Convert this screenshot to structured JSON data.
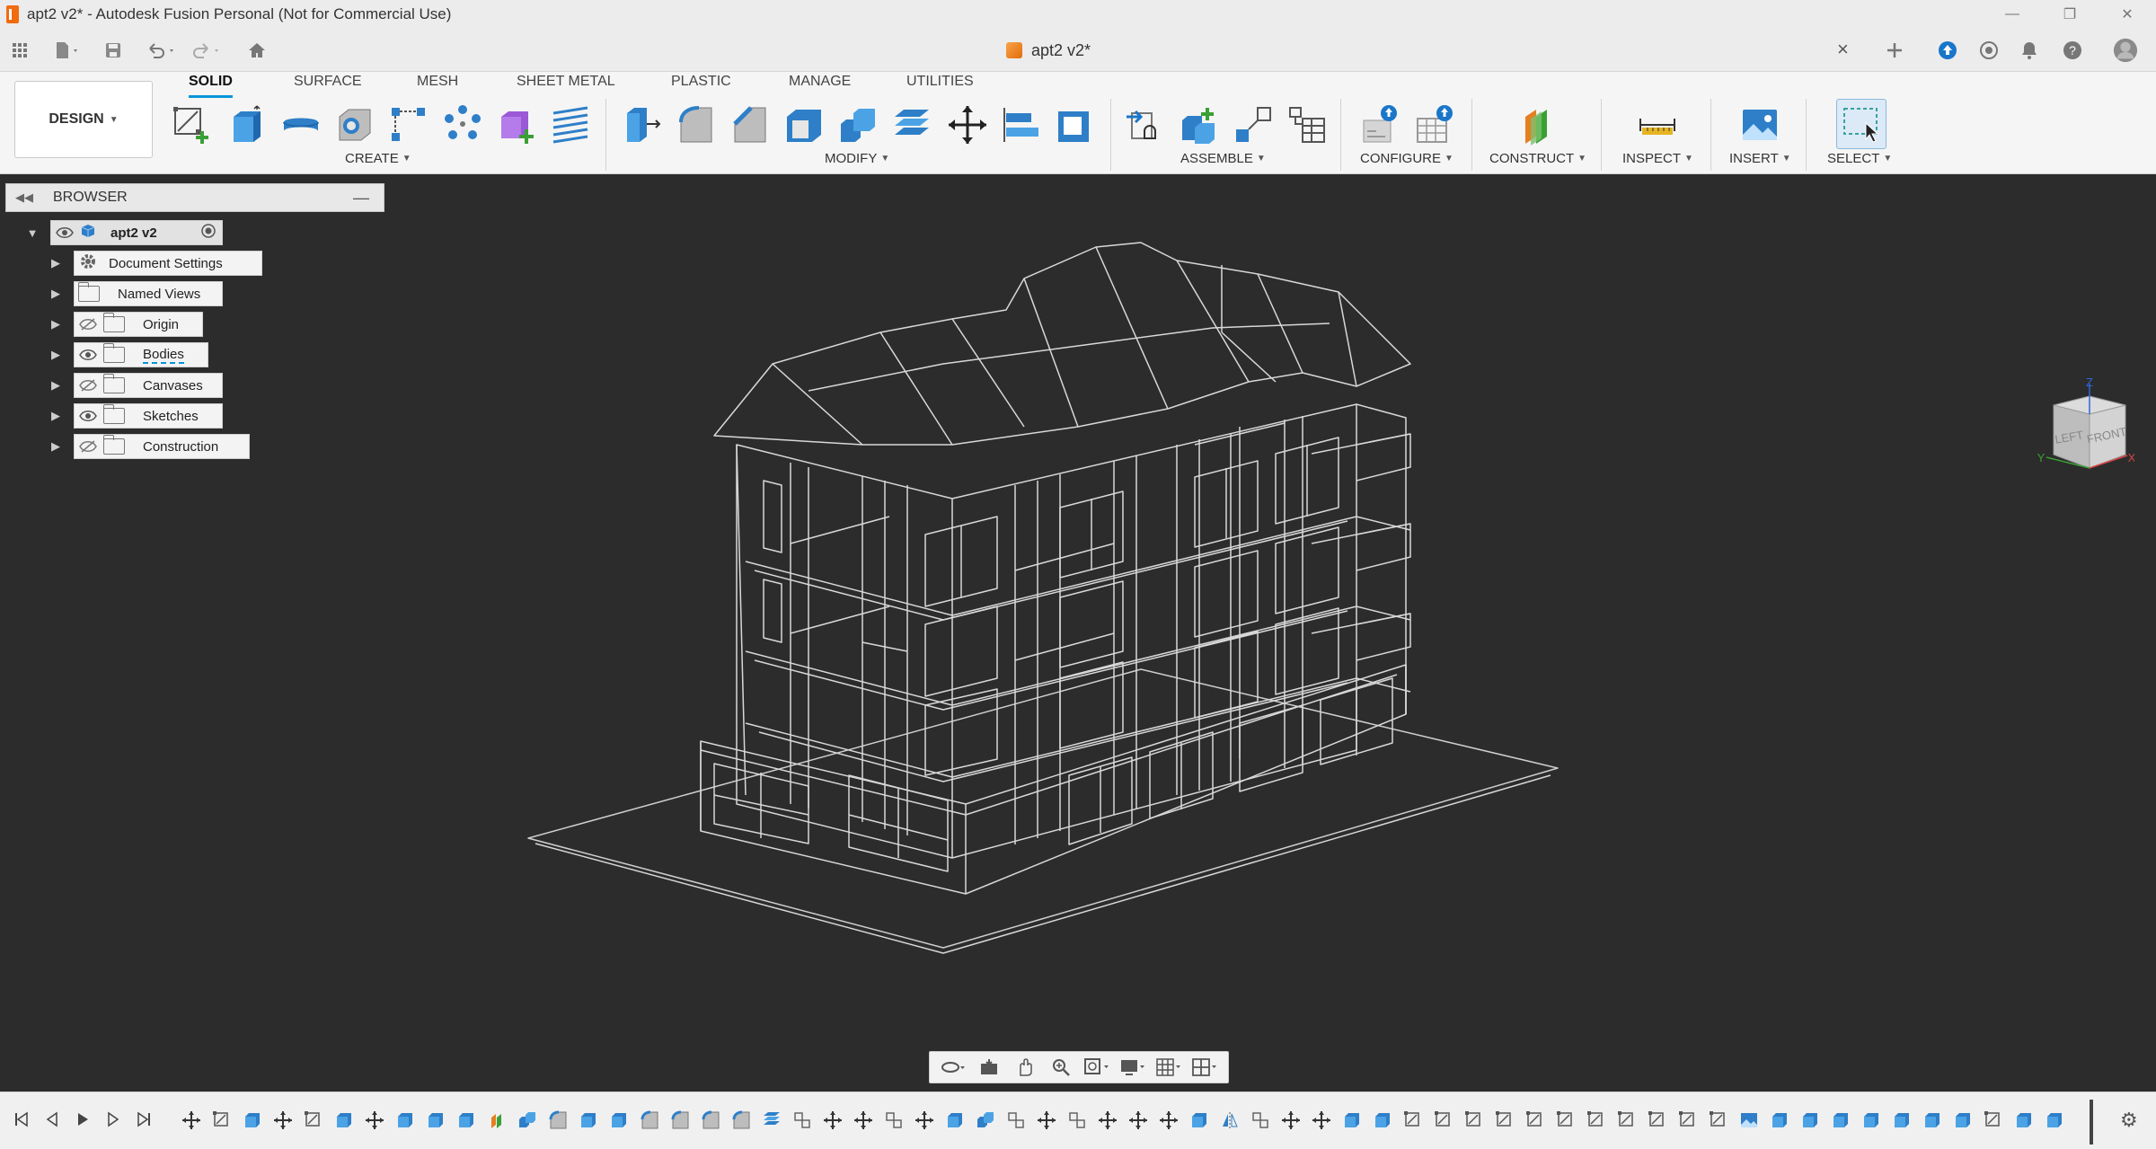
{
  "window": {
    "title": "apt2 v2* - Autodesk Fusion Personal (Not for Commercial Use)",
    "controls": [
      "minimize-icon",
      "restore-icon",
      "close-icon"
    ]
  },
  "document_tab": {
    "name": "apt2 v2*",
    "close": "×"
  },
  "quick_access": [
    "grid-icon",
    "file-icon",
    "save-icon",
    "undo-icon",
    "redo-icon",
    "home-icon"
  ],
  "header_right_icons": [
    "plus-icon",
    "upload-icon",
    "clock-icon",
    "bell-icon",
    "help-icon",
    "profile-icon"
  ],
  "workspace": {
    "label": "DESIGN"
  },
  "tabs": [
    {
      "label": "SOLID",
      "active": true
    },
    {
      "label": "SURFACE",
      "active": false
    },
    {
      "label": "MESH",
      "active": false
    },
    {
      "label": "SHEET METAL",
      "active": false
    },
    {
      "label": "PLASTIC",
      "active": false
    },
    {
      "label": "MANAGE",
      "active": false
    },
    {
      "label": "UTILITIES",
      "active": false
    }
  ],
  "groups": [
    {
      "label": "CREATE"
    },
    {
      "label": "MODIFY"
    },
    {
      "label": "ASSEMBLE"
    },
    {
      "label": "CONFIGURE"
    },
    {
      "label": "CONSTRUCT"
    },
    {
      "label": "INSPECT"
    },
    {
      "label": "INSERT"
    },
    {
      "label": "SELECT"
    }
  ],
  "browser": {
    "title": "BROWSER",
    "root": "apt2 v2",
    "items": [
      {
        "label": "Document Settings",
        "icon": "gear-icon",
        "visibility": "none"
      },
      {
        "label": "Named Views",
        "icon": "folder-icon",
        "visibility": "none"
      },
      {
        "label": "Origin",
        "icon": "folder-icon",
        "visibility": "hidden"
      },
      {
        "label": "Bodies",
        "icon": "folder-icon",
        "visibility": "visible"
      },
      {
        "label": "Canvases",
        "icon": "folder-icon",
        "visibility": "hidden"
      },
      {
        "label": "Sketches",
        "icon": "folder-icon",
        "visibility": "visible"
      },
      {
        "label": "Construction",
        "icon": "folder-icon",
        "visibility": "hidden"
      }
    ]
  },
  "viewcube": {
    "left": "LEFT",
    "front": "FRONT",
    "axes": [
      "Z",
      "Y",
      "X"
    ]
  },
  "navbar": [
    "orbit-icon",
    "look-at-icon",
    "pan-icon",
    "zoom-icon",
    "fit-icon",
    "display-settings-icon",
    "grid-icon",
    "viewports-icon"
  ],
  "colors": {
    "accent": "#0696d7",
    "viewport_bg": "#2c2c2c",
    "wire": "#d9d9d9"
  }
}
